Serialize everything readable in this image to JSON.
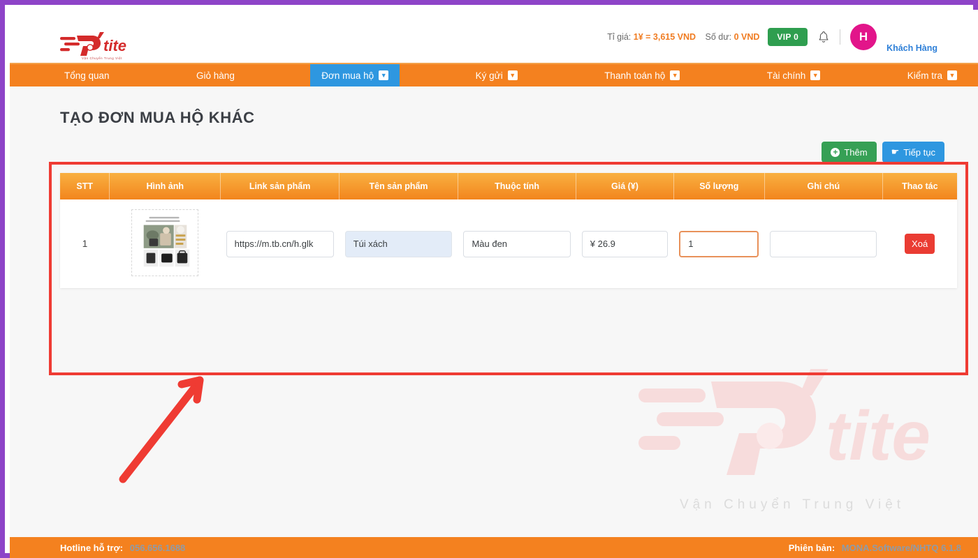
{
  "theme": {
    "frame_border": "#8e44c8",
    "orange": "#f4811f",
    "blue_active": "#2e97e0",
    "green": "#36a055",
    "red": "#ea3c33",
    "annotation_red": "#ef3b33",
    "avatar_pink": "#e2158a"
  },
  "header": {
    "logo_text": "tite",
    "logo_tagline": "Vận Chuyển Trung Việt",
    "rate_label": "Tỉ giá:",
    "rate_value": "1¥ = 3,615 VND",
    "balance_label": "Số dư:",
    "balance_value": "0 VND",
    "vip_badge": "VIP 0",
    "bell_icon": "bell-icon",
    "avatar_initial": "H",
    "user_name": "Khách Hàng"
  },
  "nav": {
    "items": [
      {
        "label": "Tổng quan",
        "has_caret": false,
        "active": false
      },
      {
        "label": "Giỏ hàng",
        "has_caret": false,
        "active": false
      },
      {
        "label": "Đơn mua hộ",
        "has_caret": true,
        "active": true
      },
      {
        "label": "Ký gửi",
        "has_caret": true,
        "active": false
      },
      {
        "label": "Thanh toán hộ",
        "has_caret": true,
        "active": false
      },
      {
        "label": "Tài chính",
        "has_caret": true,
        "active": false
      },
      {
        "label": "Kiểm tra",
        "has_caret": true,
        "active": false
      }
    ]
  },
  "page": {
    "title": "TẠO ĐƠN MUA HỘ KHÁC"
  },
  "actions": {
    "add_label": "Thêm",
    "add_icon": "plus-circle-icon",
    "continue_label": "Tiếp tục",
    "continue_icon": "hand-point-right-icon"
  },
  "table": {
    "headers": [
      "STT",
      "Hình ảnh",
      "Link sản phẩm",
      "Tên sản phẩm",
      "Thuộc tính",
      "Giá (¥)",
      "Số lượng",
      "Ghi chú",
      "Thao tác"
    ],
    "rows": [
      {
        "stt": "1",
        "image_alt": "product-thumbnail",
        "link_value": "https://m.tb.cn/h.glk",
        "link_placeholder": "",
        "name_value": "Túi xách",
        "name_placeholder": "",
        "attr_value": "Màu đen",
        "attr_placeholder": "",
        "price_value": "¥ 26.9",
        "price_placeholder": "",
        "qty_value": "1",
        "qty_placeholder": "",
        "note_value": "",
        "note_placeholder": "",
        "delete_label": "Xoá"
      }
    ]
  },
  "watermark": {
    "brand": "tite",
    "tagline": "Vận Chuyển Trung Việt"
  },
  "footer": {
    "hotline_label": "Hotline hỗ trợ:",
    "hotline_value": "056.656.1688",
    "version_label": "Phiên bản:",
    "version_value": "MONA.Software/NHTQ 6.1.8"
  },
  "annotation": {
    "arrow": "red-arrow-up-right",
    "highlight_box": "red-rectangle-around-table"
  }
}
